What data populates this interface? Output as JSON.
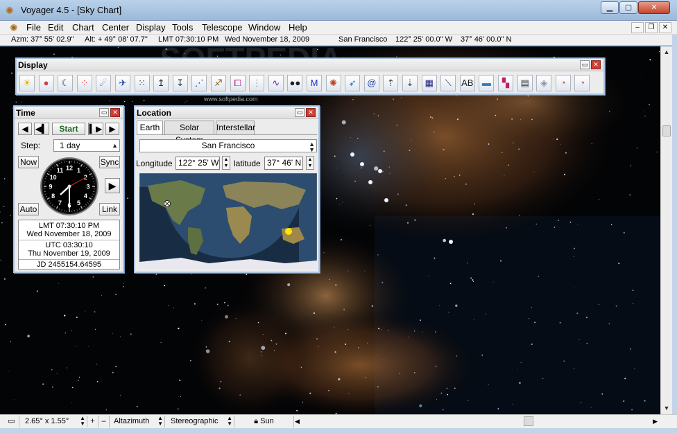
{
  "window": {
    "title": "Voyager 4.5 - [Sky Chart]",
    "controls": {
      "minimize": "▁",
      "maximize": "▢",
      "close": "✕"
    }
  },
  "menu": [
    "File",
    "Edit",
    "Chart",
    "Center",
    "Display",
    "Tools",
    "Telescope",
    "Window",
    "Help"
  ],
  "mdi_controls": {
    "minimize": "–",
    "restore": "❐",
    "close": "✕"
  },
  "status": {
    "azm": "Azm:  37° 55' 02.9\"",
    "alt": "Alt: + 49° 08' 07.7\"",
    "lmt": "LMT 07:30:10 PM",
    "date": "Wed   November 18, 2009",
    "place": "San Francisco",
    "longitude": "122° 25' 00.0\" W",
    "latitude": "37° 46' 00.0\" N"
  },
  "display_panel": {
    "title": "Display",
    "icons": [
      {
        "name": "sun-icon",
        "glyph": "☀",
        "color": "#e0b000"
      },
      {
        "name": "planets-icon",
        "glyph": "●",
        "color": "#d04040"
      },
      {
        "name": "moon-icon",
        "glyph": "☾",
        "color": "#333333"
      },
      {
        "name": "star-pattern-icon",
        "glyph": "⁘",
        "color": "#d02020"
      },
      {
        "name": "comet-icon",
        "glyph": "☄",
        "color": "#555555"
      },
      {
        "name": "satellite-icon",
        "glyph": "✈",
        "color": "#2040a0"
      },
      {
        "name": "star-field-icon",
        "glyph": "⁙",
        "color": "#2a2a2a"
      },
      {
        "name": "star-bright-icon",
        "glyph": "↥",
        "color": "#2a2a2a"
      },
      {
        "name": "star-faint-icon",
        "glyph": "↧",
        "color": "#2a2a2a"
      },
      {
        "name": "constellation-lines-icon",
        "glyph": "⋰",
        "color": "#203080"
      },
      {
        "name": "constellation-figures-icon",
        "glyph": "♐",
        "color": "#806020"
      },
      {
        "name": "constellation-boundaries-icon",
        "glyph": "⧠",
        "color": "#c02080"
      },
      {
        "name": "milky-way-icon",
        "glyph": "⋮",
        "color": "#a0a0a0"
      },
      {
        "name": "variable-star-icon",
        "glyph": "∿",
        "color": "#8020a0"
      },
      {
        "name": "double-star-icon",
        "glyph": "●●",
        "color": "#202020"
      },
      {
        "name": "messier-icon",
        "glyph": "M",
        "color": "#2030c0"
      },
      {
        "name": "nebula-icon",
        "glyph": "✺",
        "color": "#c04020"
      },
      {
        "name": "galaxy-icon",
        "glyph": "➶",
        "color": "#2060c0"
      },
      {
        "name": "spiral-icon",
        "glyph": "@",
        "color": "#2040a0"
      },
      {
        "name": "ra-up-icon",
        "glyph": "⇡",
        "color": "#404040"
      },
      {
        "name": "ra-down-icon",
        "glyph": "⇣",
        "color": "#404040"
      },
      {
        "name": "grid-icon",
        "glyph": "▦",
        "color": "#202080"
      },
      {
        "name": "horizon-icon",
        "glyph": "⟍",
        "color": "#303030"
      },
      {
        "name": "labels-icon",
        "glyph": "AB",
        "color": "#202020"
      },
      {
        "name": "landscape-icon",
        "glyph": "▬",
        "color": "#3080c0"
      },
      {
        "name": "color-icon",
        "glyph": "▚",
        "color": "#c02060"
      },
      {
        "name": "info-icon",
        "glyph": "▤",
        "color": "#303030"
      },
      {
        "name": "eraser-icon",
        "glyph": "◈",
        "color": "#9090a0"
      },
      {
        "name": "dial-icon",
        "glyph": "◔",
        "color": "#c05050"
      },
      {
        "name": "dial-two-icon",
        "glyph": "◔",
        "color": "#c05050"
      }
    ]
  },
  "time_panel": {
    "title": "Time",
    "start_label": "Start",
    "step_label": "Step:",
    "step_value": "1 day",
    "now_label": "Now",
    "sync_label": "Sync",
    "auto_label": "Auto",
    "link_label": "Link",
    "lmt_time": "LMT 07:30:10 PM",
    "lmt_date": "Wed November 18, 2009",
    "utc_time": "UTC 03:30:10",
    "utc_date": "Thu November 19, 2009",
    "jd": "JD 2455154.64595",
    "clock_numbers": [
      "12",
      "1",
      "2",
      "3",
      "4",
      "5",
      "6",
      "7",
      "8",
      "9",
      "10",
      "11"
    ]
  },
  "location_panel": {
    "title": "Location",
    "tabs": [
      "Earth",
      "Solar System",
      "Interstellar"
    ],
    "active_tab": "Earth",
    "place": "San Francisco",
    "longitude_label": "Longitude",
    "longitude_value": "122° 25' W",
    "latitude_label": "latitude",
    "latitude_value": "37° 46' N"
  },
  "bottom": {
    "fov": "2.65° x 1.55°",
    "plus": "+",
    "minus": "–",
    "mount": "Altazimuth",
    "projection": "Stereographic",
    "lock": "Sun"
  },
  "watermark": "SOFTPEDIA",
  "watermark_small": "www.softpedia.com",
  "colors": {
    "accent": "#a8c4e3",
    "sky": "#030406",
    "nebula": "#c8753a",
    "sun_marker": "#ffe600"
  }
}
